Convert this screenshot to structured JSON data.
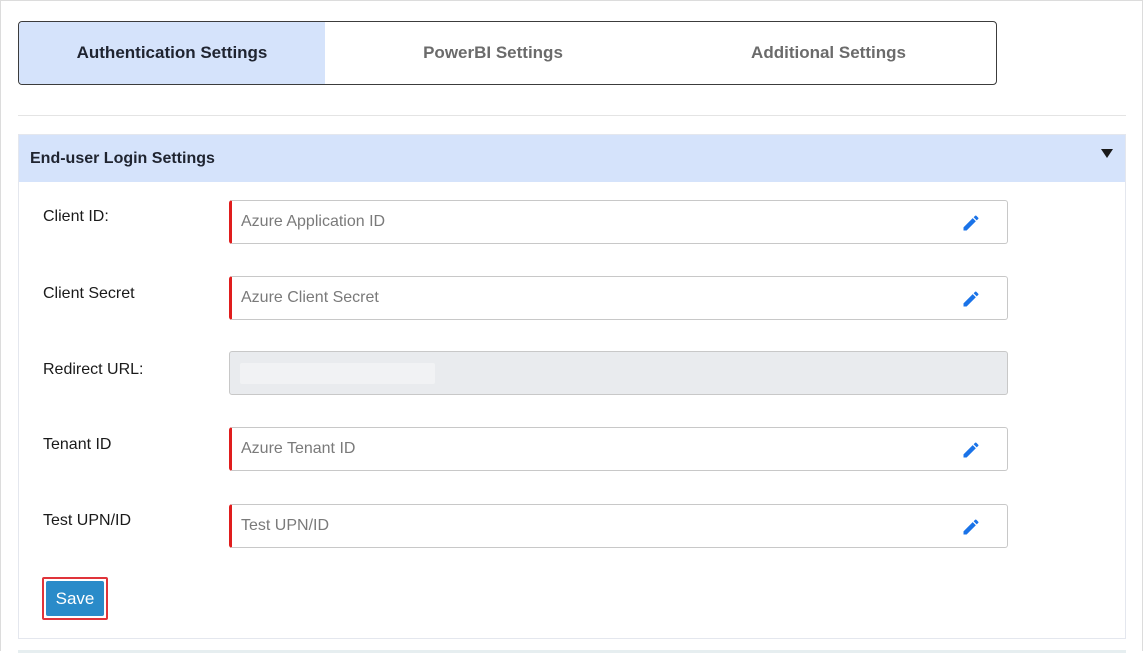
{
  "tabs": [
    {
      "label": "Authentication Settings",
      "active": true
    },
    {
      "label": "PowerBI Settings",
      "active": false
    },
    {
      "label": "Additional Settings",
      "active": false
    }
  ],
  "section": {
    "title": "End-user Login Settings",
    "caret_icon": "caret-down-icon"
  },
  "fields": {
    "client_id": {
      "label": "Client ID:",
      "placeholder": "Azure Application ID",
      "value": ""
    },
    "client_secret": {
      "label": "Client Secret",
      "placeholder": "Azure Client Secret",
      "value": ""
    },
    "redirect_url": {
      "label": "Redirect URL:",
      "value": ""
    },
    "tenant_id": {
      "label": "Tenant ID",
      "placeholder": "Azure Tenant ID",
      "value": ""
    },
    "test_upn": {
      "label": "Test UPN/ID",
      "placeholder": "Test UPN/ID",
      "value": ""
    }
  },
  "icons": {
    "edit": "pencil-icon"
  },
  "colors": {
    "active_tab": "#d5e3fb",
    "required_marker": "#e01d1d",
    "edit_icon": "#1a73e8",
    "save_button": "#2a8bc9",
    "save_highlight": "#e0343a"
  },
  "actions": {
    "save_label": "Save"
  }
}
